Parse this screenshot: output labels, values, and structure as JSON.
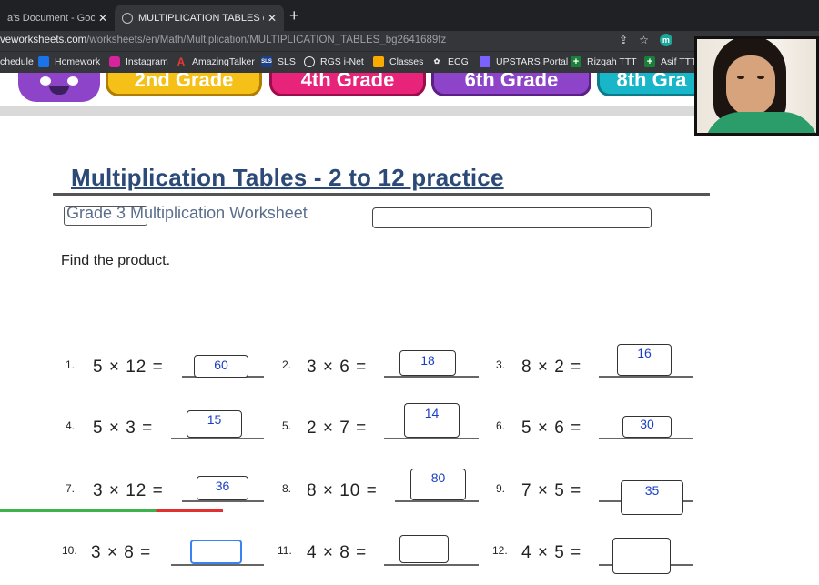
{
  "browser": {
    "tabs": [
      {
        "title": "a's Document - Google D",
        "close": "✕"
      },
      {
        "title": "MULTIPLICATION TABLES onli",
        "close": "✕"
      }
    ],
    "new_tab": "+",
    "url_domain": "veworksheets.com",
    "url_path": "/worksheets/en/Math/Multiplication/MULTIPLICATION_TABLES_bg2641689fz",
    "ext_letter": "m",
    "bookmarks": [
      {
        "label": "chedule",
        "icon": "none"
      },
      {
        "label": "Homework",
        "icon": "bookmark-blue"
      },
      {
        "label": "Instagram",
        "icon": "instagram"
      },
      {
        "label": "AmazingTalker",
        "icon": "letter-a"
      },
      {
        "label": "SLS",
        "icon": "sls"
      },
      {
        "label": "RGS i-Net",
        "icon": "globe"
      },
      {
        "label": "Classes",
        "icon": "classroom"
      },
      {
        "label": "ECG",
        "icon": "ecg"
      },
      {
        "label": "UPSTARS Portal",
        "icon": "upstars"
      },
      {
        "label": "Rizqah TTT",
        "icon": "plus-green"
      },
      {
        "label": "Asif TTT",
        "icon": "plus-green"
      }
    ]
  },
  "grades": [
    "2nd Grade",
    "4th Grade",
    "6th Grade",
    "8th Gra"
  ],
  "worksheet": {
    "title": "Multiplication Tables - 2 to 12 practice",
    "subtitle": "Grade 3 Multiplication Worksheet",
    "instruction": "Find the product.",
    "problems": [
      {
        "num": "1.",
        "expr": "5 × 12 =",
        "answer": "60"
      },
      {
        "num": "2.",
        "expr": "3 × 6 =",
        "answer": "18"
      },
      {
        "num": "3.",
        "expr": "8 × 2 =",
        "answer": "16"
      },
      {
        "num": "4.",
        "expr": "5 × 3 =",
        "answer": "15"
      },
      {
        "num": "5.",
        "expr": "2 × 7 =",
        "answer": "14"
      },
      {
        "num": "6.",
        "expr": "5 × 6 =",
        "answer": "30"
      },
      {
        "num": "7.",
        "expr": "3 × 12 =",
        "answer": "36"
      },
      {
        "num": "8.",
        "expr": "8 × 10 =",
        "answer": "80"
      },
      {
        "num": "9.",
        "expr": "7 × 5 =",
        "answer": "35"
      },
      {
        "num": "10.",
        "expr": "3 × 8 =",
        "answer": ""
      },
      {
        "num": "11.",
        "expr": "4 × 8 =",
        "answer": ""
      },
      {
        "num": "12.",
        "expr": "4 × 5 =",
        "answer": ""
      }
    ]
  },
  "colors": {
    "title": "#2c4a78",
    "answer_text": "#1a3ec4",
    "grade_yellow": "#f5c118",
    "grade_pink": "#e8247a",
    "grade_purple": "#8e44c8",
    "grade_teal": "#19b5c8"
  }
}
